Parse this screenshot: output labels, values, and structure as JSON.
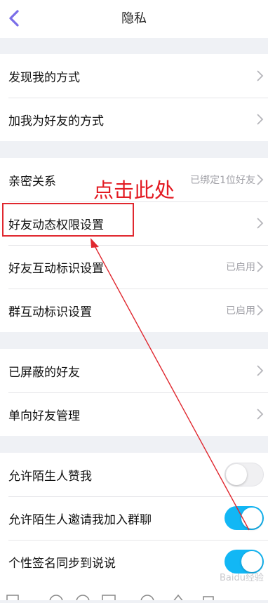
{
  "header": {
    "title": "隐私"
  },
  "groups": [
    {
      "rows": [
        {
          "label": "发现我的方式"
        },
        {
          "label": "加我为好友的方式"
        }
      ]
    },
    {
      "rows": [
        {
          "label": "亲密关系",
          "value": "已绑定1位好友"
        },
        {
          "label": "好友动态权限设置"
        },
        {
          "label": "好友互动标识设置",
          "value": "已启用"
        },
        {
          "label": "群互动标识设置",
          "value": "已启用"
        }
      ]
    },
    {
      "rows": [
        {
          "label": "已屏蔽的好友"
        },
        {
          "label": "单向好友管理"
        }
      ]
    },
    {
      "rows": [
        {
          "label": "允许陌生人赞我",
          "toggle": false
        },
        {
          "label": "允许陌生人邀请我加入群聊",
          "toggle": true
        },
        {
          "label": "个性签名同步到说说",
          "toggle": true
        }
      ]
    }
  ],
  "annotation": {
    "text": "点击此处"
  },
  "watermark": "Baidu经验",
  "colors": {
    "accent": "#12b7f5",
    "back_arrow": "#7a6ee8",
    "annotation": "#e31b23"
  }
}
